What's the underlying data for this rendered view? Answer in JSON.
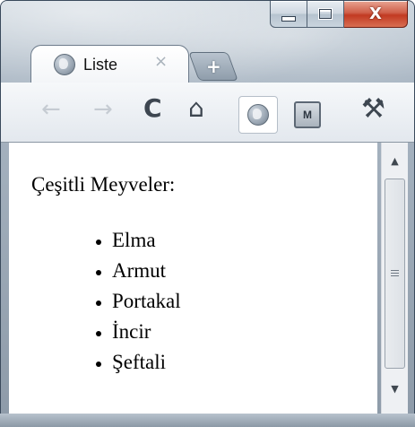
{
  "window": {
    "caption_buttons": {
      "minimize_icon": "minimize-icon",
      "maximize_icon": "maximize-icon",
      "close_glyph": "X"
    }
  },
  "tab": {
    "title": "Liste",
    "favicon": "globe-icon",
    "close_glyph": "×",
    "new_tab_glyph": "+"
  },
  "toolbar": {
    "back_glyph": "←",
    "forward_glyph": "→",
    "reload_glyph": "C",
    "home_glyph": "⌂",
    "extension_label": "M",
    "wrench_glyph": "⚒"
  },
  "content": {
    "heading": "Çeşitli Meyveler:",
    "items": [
      "Elma",
      "Armut",
      "Portakal",
      "İncir",
      "Şeftali"
    ]
  },
  "scrollbar": {
    "up_glyph": "▲",
    "down_glyph": "▼"
  }
}
